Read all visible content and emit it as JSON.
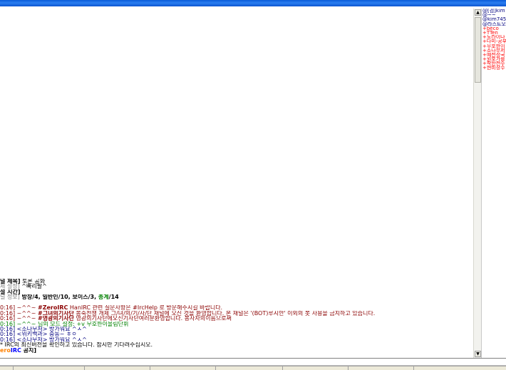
{
  "chat": {
    "lines": [
      {
        "segs": [
          {
            "t": "널 제목]",
            "cls": "b"
          },
          {
            "t": " 토론 공화",
            "cls": ""
          }
        ]
      },
      {
        "segs": [
          {
            "t": "제 설정]",
            "cls": "c-gray"
          },
          {
            "t": " ^빠리팔^",
            "cls": ""
          }
        ]
      },
      {
        "segs": [
          {
            "t": "설 시간]",
            "cls": "b"
          }
        ]
      },
      {
        "segs": [
          {
            "t": "널 정보]",
            "cls": "c-gray"
          },
          {
            "t": " 방장/4, 일반인/10, 보이스/3, ",
            "cls": "b"
          },
          {
            "t": "총계",
            "cls": "b c-green"
          },
          {
            "t": "/14",
            "cls": "b"
          }
        ]
      },
      {
        "segs": [
          {
            "t": "",
            "cls": ""
          }
        ],
        "gap": true
      },
      {
        "segs": [
          {
            "t": "0:16] ~^^~ ",
            "cls": "c-darkred"
          },
          {
            "t": "#ZeroIRC",
            "cls": "b c-darkred"
          },
          {
            "t": " HanIRC 관련 질문사항은 #IrcHelp 로 방문해주시길 바랍니다.",
            "cls": "c-darkred"
          }
        ]
      },
      {
        "segs": [
          {
            "t": "0:16] ~^^~ ",
            "cls": "c-darkred"
          },
          {
            "t": "#그녀의기사단",
            "cls": "b c-darkred"
          },
          {
            "t": " 봉죽전쟁 개체 그/녀/의/기/사/단 채널에 오신 것을 환영합니다. 본 채널은 '(BOT)루시안' 이외의 봇 사용을 금지하고 있습니다.",
            "cls": "c-darkred"
          }
        ]
      },
      {
        "segs": [
          {
            "t": "0:16] ~^^~ ",
            "cls": "c-darkred"
          },
          {
            "t": "#영광의기사단",
            "cls": "b c-darkred"
          },
          {
            "t": " 영광의기사단에오신기사단여러분환영합니다. 봉사자의이름으로써",
            "cls": "c-darkred"
          }
        ]
      },
      {
        "segs": [
          {
            "t": "0:16] ~^^~ ",
            "cls": "c-green"
          },
          {
            "t": "님의 모드 설정: +v 무호한이올림단휘",
            "cls": "c-green"
          }
        ]
      },
      {
        "segs": [
          {
            "t": "0:16] <",
            "cls": "c-navy"
          },
          {
            "t": "소나무저",
            "cls": "c-navy"
          },
          {
            "t": "> 방가워요 ^ㅅ^",
            "cls": "c-navy"
          }
        ]
      },
      {
        "segs": [
          {
            "t": "0:16] <",
            "cls": "c-navy"
          },
          {
            "t": "위키백과",
            "cls": "c-navy"
          },
          {
            "t": "> 중동~ ㅎㅇ",
            "cls": "c-navy"
          }
        ]
      },
      {
        "segs": [
          {
            "t": "0:16] <",
            "cls": "c-navy"
          },
          {
            "t": "소나무저",
            "cls": "c-navy"
          },
          {
            "t": "> 방가워요 ^ㅅ^",
            "cls": "c-navy"
          }
        ]
      },
      {
        "segs": [
          {
            "t": "* IRC의 최신버전을 확인하고 있습니다. 잠시만 기다려주십시오.",
            "cls": ""
          }
        ]
      },
      {
        "segs": [
          {
            "t": "ero",
            "cls": "b c-orange"
          },
          {
            "t": "IRC",
            "cls": "b c-blue"
          },
          {
            "t": " 공지]",
            "cls": "b"
          }
        ]
      }
    ]
  },
  "nicklist": [
    {
      "nick": "@[검]kim",
      "color": "#000080"
    },
    {
      "nick": "@~~",
      "color": "#000080"
    },
    {
      "nick": "@kim7453",
      "color": "#000080"
    },
    {
      "nick": "@라스트오",
      "color": "#000080"
    },
    {
      "nick": "+beco",
      "color": "#ff0000"
    },
    {
      "nick": "+TTen",
      "color": "#ff0000"
    },
    {
      "nick": "+노라이나",
      "color": "#ff0000"
    },
    {
      "nick": "+다미-공부",
      "color": "#ff0000"
    },
    {
      "nick": "+무호한이",
      "color": "#ff0000"
    },
    {
      "nick": "+소나무저",
      "color": "#ff0000"
    },
    {
      "nick": "+예천성국",
      "color": "#ff0000"
    },
    {
      "nick": "+원호가를",
      "color": "#ff0000"
    },
    {
      "nick": "+착한천수",
      "color": "#ff0000"
    },
    {
      "nick": "+현비장수",
      "color": "#ff0000"
    }
  ],
  "scrollbar": {
    "up_glyph": "▲",
    "down_glyph": "▼"
  },
  "colors": {
    "titlebar": "#0a5bd8",
    "op": "#000080",
    "voice": "#ff0000"
  }
}
